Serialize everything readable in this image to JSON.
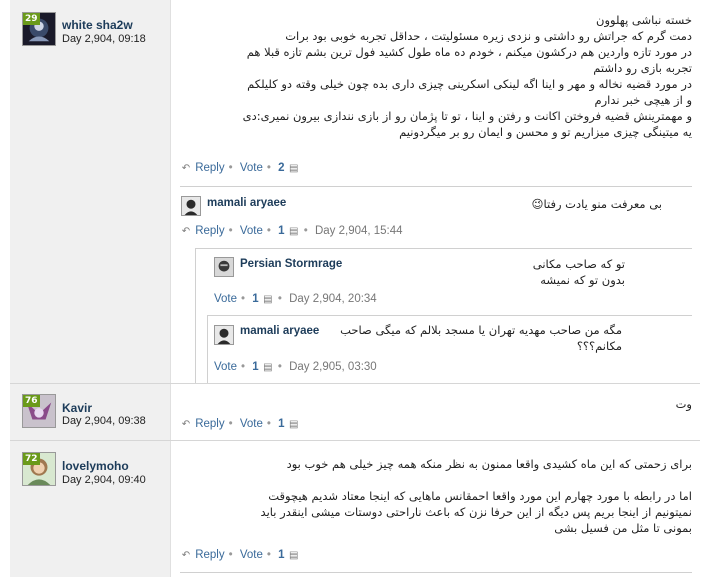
{
  "posts": [
    {
      "level": "29",
      "username": "white sha2w",
      "date": "Day 2,904, 09:18",
      "text_lines": [
        "خسته نباشی پهلوون",
        "دمت گرم که جراتش رو داشتی و نزدی زیره مسئولیتت ، حداقل تجربه خوبی بود برات",
        "در مورد تازه واردین هم درکشون میکنم ، خودم ده ماه طول کشید فول ترین بشم تازه قبلا هم",
        "تجربه بازی رو داشتم",
        "در مورد قضیه نخاله و مهر و اینا اگه لینکی اسکرینی چیزی داری بده چون خیلی وقته دو کلیلکم",
        "و از هیچی خبر ندارم",
        "و مهمترینش قضیه فروختن اکانت و رفتن و اینا ، تو تا پژمان رو از بازی نندازی بیرون نمیری:دی",
        "یه میتینگی چیزی میزاریم تو و محسن و ایمان رو بر میگردونیم"
      ],
      "reply": "Reply",
      "vote": "Vote",
      "score": "2"
    },
    {
      "level": "76",
      "username": "Kavir",
      "date": "Day 2,904, 09:38",
      "text_lines": [
        "وت"
      ],
      "reply": "Reply",
      "vote": "Vote",
      "score": "1"
    },
    {
      "level": "72",
      "username": "lovelymoho",
      "date": "Day 2,904, 09:40",
      "text_lines": [
        "برای زحمتی که این ماه کشیدی واقعا ممنون به نظر منکه همه چیز خیلی هم خوب بود",
        "",
        "اما در رابطه با مورد چهارم این مورد واقعا احمقانس ماهایی که اینجا معتاد شدیم هیچوقت",
        "نمیتونیم از اینجا بریم پس دیگه از این حرفا نزن که باعث ناراحتی دوستات میشی اینقدر باید",
        "بمونی تا مثل من فسیل بشی"
      ],
      "reply": "Reply",
      "vote": "Vote",
      "score": "1"
    }
  ],
  "replies": [
    {
      "username": "mamali aryaee",
      "text": "بی معرفت منو یادت رفتا😉",
      "reply": "Reply",
      "vote": "Vote",
      "score": "1",
      "date": "Day 2,904, 15:44"
    },
    {
      "username": "Persian Stormrage",
      "text_lines": [
        "تو که صاحب مکانی",
        "بدون تو که نمیشه"
      ],
      "vote": "Vote",
      "score": "1",
      "date": "Day 2,904, 20:34"
    },
    {
      "username": "mamali aryaee",
      "text_lines": [
        "مگه من صاحب مهدیه تهران یا مسجد بلالم که میگی صاحب",
        "مکانم؟؟؟"
      ],
      "vote": "Vote",
      "score": "1",
      "date": "Day 2,905, 03:30"
    }
  ],
  "colors": {
    "level_badge": "#6a9a1a",
    "link": "#3a6a9a",
    "username": "#1d3c5a"
  }
}
